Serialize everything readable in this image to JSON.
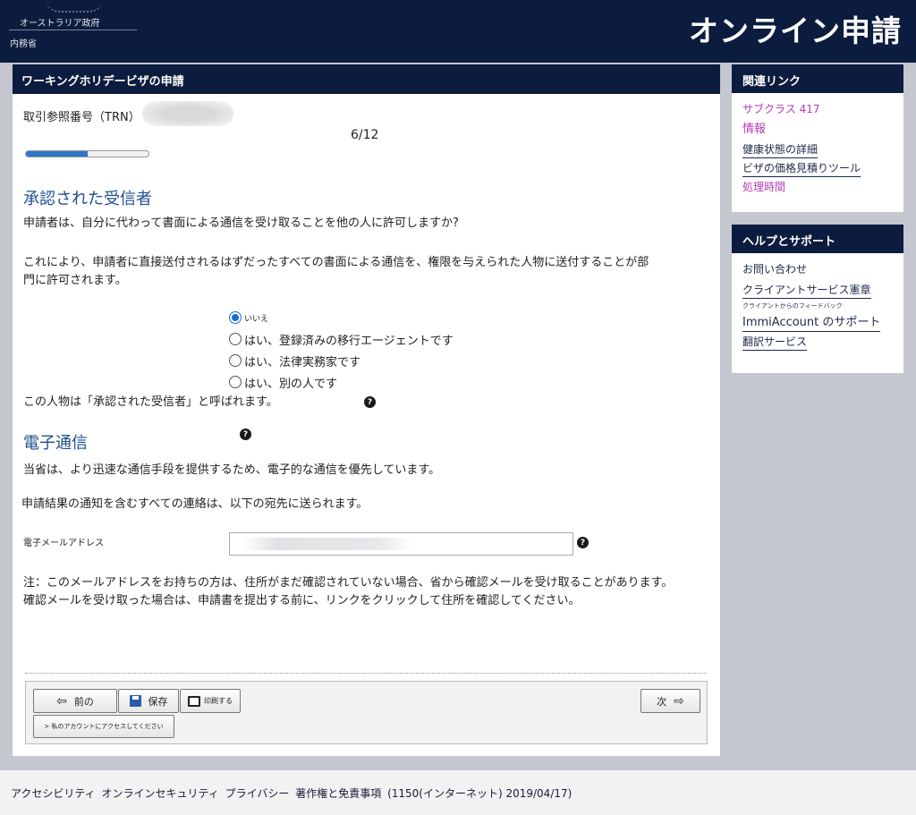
{
  "header": {
    "gov_name": "オーストラリア政府",
    "dept_name": "内務省",
    "site_title": "オンライン申請"
  },
  "main": {
    "panel_title": "ワーキングホリデービザの申請",
    "trn_label": "取引参照番号（TRN）",
    "step_count": "6/12",
    "progress_fraction": 0.5,
    "recipient_section": {
      "title": "承認された受信者",
      "question": "申請者は、自分に代わって書面による通信を受け取ることを他の人に許可しますか?",
      "explanation": "これにより、申請者に直接送付されるはずだったすべての書面による通信を、権限を与えられた人物に送付することが部門に許可されます。",
      "options": [
        {
          "label": "いいえ",
          "checked": true
        },
        {
          "label": "はい、登録済みの移行エージェントです",
          "checked": false
        },
        {
          "label": "はい、法律実務家です",
          "checked": false
        },
        {
          "label": "はい、別の人です",
          "checked": false
        }
      ],
      "note": "この人物は「承認された受信者」と呼ばれます。"
    },
    "electronic_section": {
      "title": "電子通信",
      "preference": "当省は、より迅速な通信手段を提供するため、電子的な通信を優先しています。",
      "all_comms": "申請結果の通知を含むすべての連絡は、以下の宛先に送られます。",
      "email_label": "電子メールアドレス",
      "email_note": "注：このメールアドレスをお持ちの方は、住所がまだ確認されていない場合、省から確認メールを受け取ることがあります。確認メールを受け取った場合は、申請書を提出する前に、リンクをクリックして住所を確認してください。"
    },
    "buttons": {
      "prev": "前の",
      "save": "保存",
      "print": "印刷する",
      "next": "次",
      "account": "> 私のアカウントにアクセスしてください"
    }
  },
  "sidebar": {
    "related": {
      "title": "関連リンク",
      "links": [
        "サブクラス 417",
        "情報",
        "健康状態の詳細",
        "ビザの価格見積りツール",
        "処理時間"
      ]
    },
    "help": {
      "title": "ヘルプとサポート",
      "links": [
        "お問い合わせ",
        "クライアントサービス憲章",
        "クライアントからのフィードバック",
        "ImmiAccount のサポート",
        "翻訳サービス"
      ]
    }
  },
  "footer": {
    "links": [
      "アクセシビリティ",
      "オンラインセキュリティ",
      "プライバシー",
      "著作権と免責事項"
    ],
    "version": "(1150(インターネット) 2019/04/17)"
  },
  "colors": {
    "navy": "#0c1c3e",
    "accent_blue": "#1e4f8f",
    "progress_blue": "#2b78c8",
    "link_magenta": "#b43cb8"
  }
}
